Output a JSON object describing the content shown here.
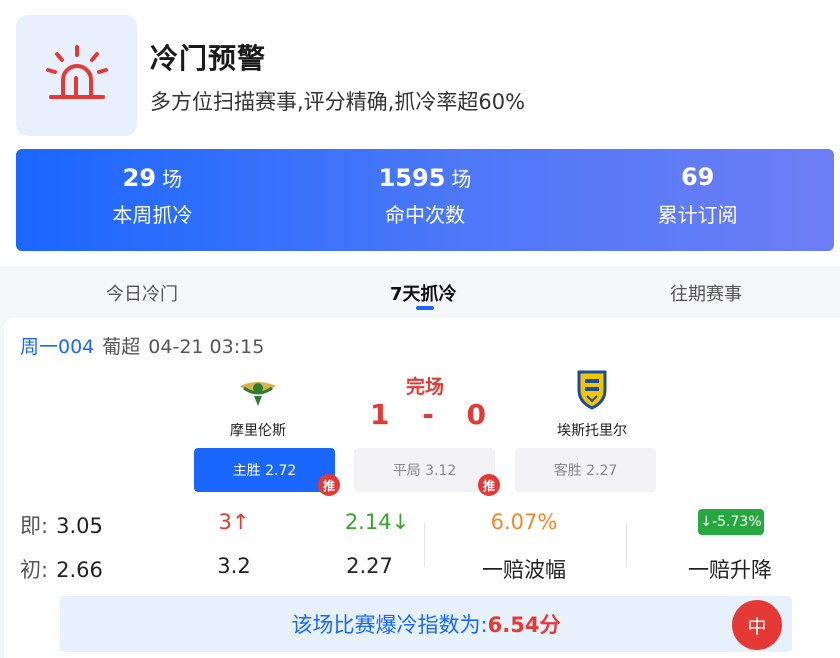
{
  "header": {
    "title": "冷门预警",
    "subtitle": "多方位扫描赛事,评分精确,抓冷率超60%",
    "icon": "alarm-siren-icon",
    "accent": "#e53935"
  },
  "stats": [
    {
      "value": "29",
      "unit": "场",
      "label": "本周抓冷"
    },
    {
      "value": "1595",
      "unit": "场",
      "label": "命中次数"
    },
    {
      "value": "69",
      "unit": "",
      "label": "累计订阅"
    }
  ],
  "tabs": [
    {
      "label": "今日冷门",
      "active": false
    },
    {
      "label": "7天抓冷",
      "active": true
    },
    {
      "label": "往期赛事",
      "active": false
    }
  ],
  "match": {
    "code": "周一004",
    "league": "葡超",
    "time": "04-21 03:15",
    "status": "完场",
    "home": {
      "name": "摩里伦斯",
      "score": "1",
      "logo": "moreirense-crest-icon"
    },
    "away": {
      "name": "埃斯托里尔",
      "score": "0",
      "logo": "estoril-crest-icon"
    },
    "score_sep": "-",
    "odds_buttons": [
      {
        "label": "主胜 2.72",
        "selected": true,
        "recommended": true
      },
      {
        "label": "平局 3.12",
        "selected": false,
        "recommended": true
      },
      {
        "label": "客胜 2.27",
        "selected": false,
        "recommended": false
      }
    ],
    "recommend_badge": "推",
    "live_row": {
      "label": "即:",
      "home": "3.05",
      "draw": "3↑",
      "away": "2.14↓",
      "amplitude": "6.07%",
      "change": "↓-5.73%"
    },
    "initial_row": {
      "label": "初:",
      "home": "2.66",
      "draw": "3.2",
      "away": "2.27",
      "amplitude_label": "一赔波幅",
      "change_label": "一赔升降"
    },
    "index_text": "该场比赛爆冷指数为:",
    "index_value": "6.54分",
    "result_badge": "中"
  }
}
